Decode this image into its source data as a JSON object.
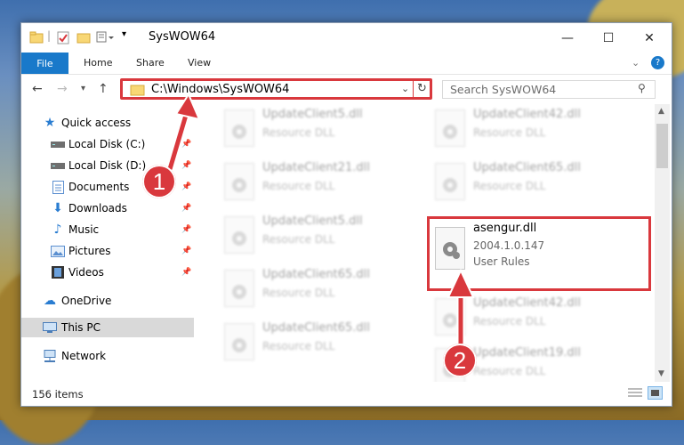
{
  "window": {
    "title": "SysWOW64",
    "controls": {
      "minimize": "—",
      "maximize": "☐",
      "close": "✕"
    }
  },
  "ribbon": {
    "tabs": [
      "File",
      "Home",
      "Share",
      "View"
    ]
  },
  "navigation": {
    "address": "C:\\Windows\\SysWOW64",
    "search_placeholder": "Search SysWOW64"
  },
  "sidebar": {
    "items": [
      {
        "label": "Quick access"
      },
      {
        "label": "Local Disk (C:)"
      },
      {
        "label": "Local Disk (D:)"
      },
      {
        "label": "Documents"
      },
      {
        "label": "Downloads"
      },
      {
        "label": "Music"
      },
      {
        "label": "Pictures"
      },
      {
        "label": "Videos"
      },
      {
        "label": "OneDrive"
      },
      {
        "label": "This PC"
      },
      {
        "label": "Network"
      }
    ]
  },
  "files": {
    "left": [
      {
        "name": "UpdateClient5.dll",
        "type": "Resource DLL"
      },
      {
        "name": "UpdateClient21.dll",
        "type": "Resource DLL"
      },
      {
        "name": "UpdateClient5.dll",
        "type": "Resource DLL"
      },
      {
        "name": "UpdateClient65.dll",
        "type": "Resource DLL"
      },
      {
        "name": "UpdateClient65.dll",
        "type": "Resource DLL"
      }
    ],
    "right": [
      {
        "name": "UpdateClient42.dll",
        "type": "Resource DLL"
      },
      {
        "name": "UpdateClient65.dll",
        "type": "Resource DLL"
      },
      {
        "name": "asengur.dll",
        "type": "2004.1.0.147",
        "sub": "User Rules"
      },
      {
        "name": "UpdateClient42.dll",
        "type": "Resource DLL"
      },
      {
        "name": "UpdateClient19.dll",
        "type": "Resource DLL"
      }
    ]
  },
  "status": {
    "item_count": "156 items"
  },
  "callouts": {
    "one": "1",
    "two": "2"
  },
  "colors": {
    "accent": "#1979ca",
    "highlight": "#d9383d"
  }
}
